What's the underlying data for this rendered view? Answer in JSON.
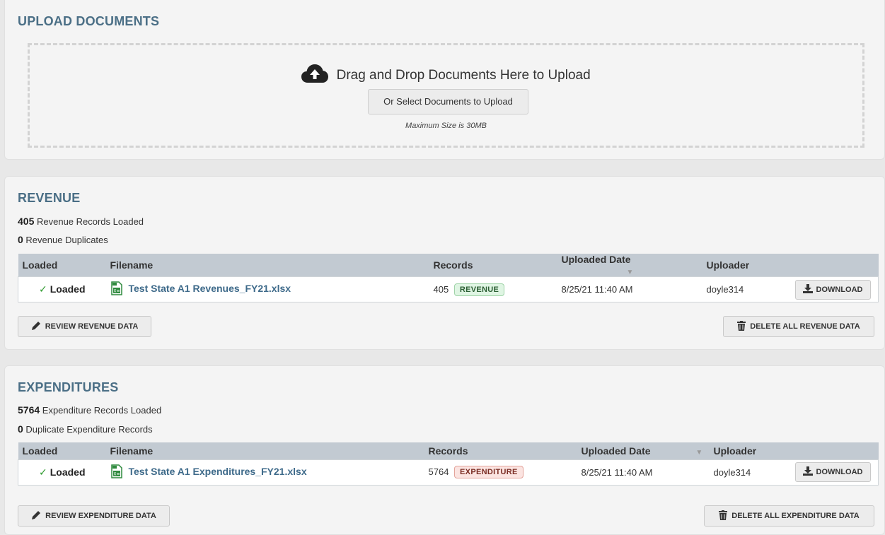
{
  "upload": {
    "title": "UPLOAD DOCUMENTS",
    "drop_text": "Drag and Drop Documents Here to Upload",
    "select_button": "Or Select Documents to Upload",
    "max_size": "Maximum Size is 30MB"
  },
  "revenue": {
    "title": "REVENUE",
    "records_count": "405",
    "records_text": "Revenue Records Loaded",
    "dup_count": "0",
    "dup_text": "Revenue Duplicates",
    "columns": [
      "Loaded",
      "Filename",
      "Records",
      "Uploaded Date",
      "Uploader"
    ],
    "row": {
      "loaded": "Loaded",
      "filename": "Test State A1 Revenues_FY21.xlsx",
      "records": "405",
      "badge": "REVENUE",
      "uploaded_date": "8/25/21 11:40 AM",
      "uploader": "doyle314",
      "download": "DOWNLOAD"
    },
    "review_button": "REVIEW REVENUE DATA",
    "delete_button": "DELETE ALL REVENUE DATA"
  },
  "expenditures": {
    "title": "EXPENDITURES",
    "records_count": "5764",
    "records_text": "Expenditure Records Loaded",
    "dup_count": "0",
    "dup_text": "Duplicate Expenditure Records",
    "columns": [
      "Loaded",
      "Filename",
      "Records",
      "Uploaded Date",
      "Uploader"
    ],
    "row": {
      "loaded": "Loaded",
      "filename": "Test State A1 Expenditures_FY21.xlsx",
      "records": "5764",
      "badge": "EXPENDITURE",
      "uploaded_date": "8/25/21 11:40 AM",
      "uploader": "doyle314",
      "download": "DOWNLOAD"
    },
    "review_button": "REVIEW EXPENDITURE DATA",
    "delete_button": "DELETE ALL EXPENDITURE DATA"
  },
  "colors": {
    "title": "#4b6f86",
    "header_bg": "#c2cad2",
    "check": "#2e9a2e",
    "revenue_badge": "#dff5e3",
    "expenditure_badge": "#fbe4e1"
  },
  "icons": [
    "cloud-upload-icon",
    "check-icon",
    "excel-file-icon",
    "download-icon",
    "pencil-icon",
    "trash-icon",
    "sort-caret-icon"
  ]
}
